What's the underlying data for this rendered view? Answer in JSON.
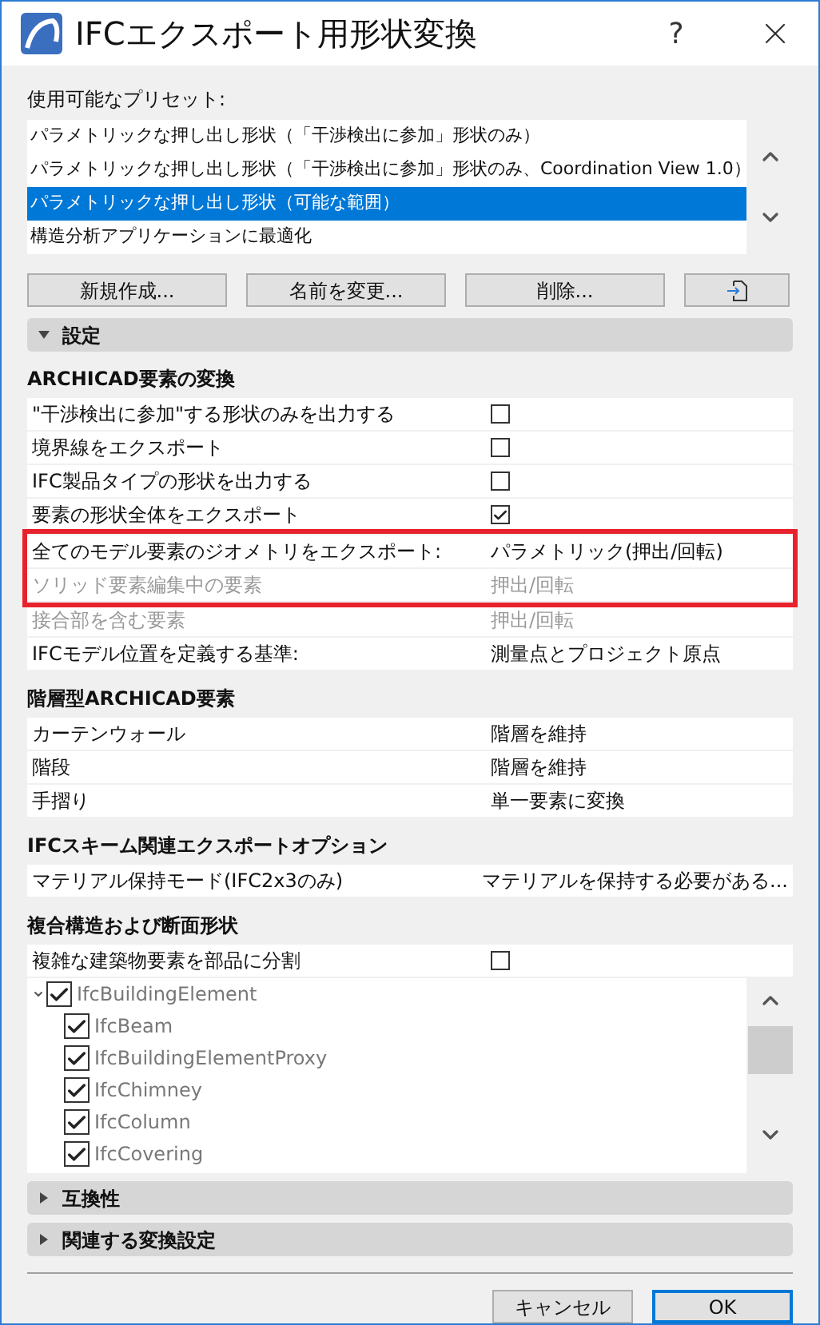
{
  "window": {
    "title": "IFCエクスポート用形状変換",
    "help": "?"
  },
  "presets": {
    "label": "使用可能なプリセット:",
    "items": [
      {
        "text": "パラメトリックな押し出し形状（「干渉検出に参加」形状のみ）",
        "selected": false
      },
      {
        "text": "パラメトリックな押し出し形状（「干渉検出に参加」形状のみ、Coordination View 1.0）",
        "selected": false
      },
      {
        "text": "パラメトリックな押し出し形状（可能な範囲）",
        "selected": true
      },
      {
        "text": "構造分析アプリケーションに最適化",
        "selected": false
      }
    ],
    "buttons": [
      "新規作成...",
      "名前を変更...",
      "削除..."
    ]
  },
  "settings": {
    "label": "設定",
    "expanded": true
  },
  "sections": [
    {
      "title": "ARCHICAD要素の変換",
      "rows": [
        {
          "kind": "checkbox",
          "label": "\"干渉検出に参加\"する形状のみを出力する",
          "checked": false,
          "disabled": false,
          "highlighted": false
        },
        {
          "kind": "checkbox",
          "label": "境界線をエクスポート",
          "checked": false,
          "disabled": false,
          "highlighted": false
        },
        {
          "kind": "checkbox",
          "label": "IFC製品タイプの形状を出力する",
          "checked": false,
          "disabled": false,
          "highlighted": false
        },
        {
          "kind": "checkbox",
          "label": "要素の形状全体をエクスポート",
          "checked": true,
          "disabled": false,
          "highlighted": false
        },
        {
          "kind": "value",
          "label": "全てのモデル要素のジオメトリをエクスポート:",
          "value": "パラメトリック(押出/回転)",
          "disabled": false,
          "highlighted": true
        },
        {
          "kind": "value",
          "label": "ソリッド要素編集中の要素",
          "value": "押出/回転",
          "disabled": true,
          "highlighted": true
        },
        {
          "kind": "value",
          "label": "接合部を含む要素",
          "value": "押出/回転",
          "disabled": true,
          "highlighted": false
        },
        {
          "kind": "value",
          "label": "IFCモデル位置を定義する基準:",
          "value": "測量点とプロジェクト原点",
          "disabled": false,
          "highlighted": false
        }
      ]
    },
    {
      "title": "階層型ARCHICAD要素",
      "rows": [
        {
          "kind": "value",
          "label": "カーテンウォール",
          "value": "階層を維持",
          "disabled": false,
          "highlighted": false
        },
        {
          "kind": "value",
          "label": "階段",
          "value": "階層を維持",
          "disabled": false,
          "highlighted": false
        },
        {
          "kind": "value",
          "label": "手摺り",
          "value": "単一要素に変換",
          "disabled": false,
          "highlighted": false
        }
      ]
    },
    {
      "title": "IFCスキーム関連エクスポートオプション",
      "rows": [
        {
          "kind": "value",
          "label": "マテリアル保持モード(IFC2x3のみ)",
          "value": "マテリアルを保持する必要がある...",
          "disabled": false,
          "highlighted": false
        }
      ]
    },
    {
      "title": "複合構造および断面形状",
      "rows": [
        {
          "kind": "checkbox",
          "label": "複雑な建築物要素を部品に分割",
          "checked": false,
          "disabled": false,
          "highlighted": false
        }
      ],
      "tree": [
        {
          "label": "IfcBuildingElement",
          "checked": true,
          "expanded": true,
          "children": [
            {
              "label": "IfcBeam",
              "checked": true
            },
            {
              "label": "IfcBuildingElementProxy",
              "checked": true
            },
            {
              "label": "IfcChimney",
              "checked": true
            },
            {
              "label": "IfcColumn",
              "checked": true
            },
            {
              "label": "IfcCovering",
              "checked": true
            }
          ]
        }
      ]
    }
  ],
  "panels": [
    {
      "label": "互換性",
      "expanded": false
    },
    {
      "label": "関連する変換設定",
      "expanded": false
    }
  ],
  "footer": [
    {
      "label": "キャンセル",
      "default": false
    },
    {
      "label": "OK",
      "default": true
    }
  ]
}
